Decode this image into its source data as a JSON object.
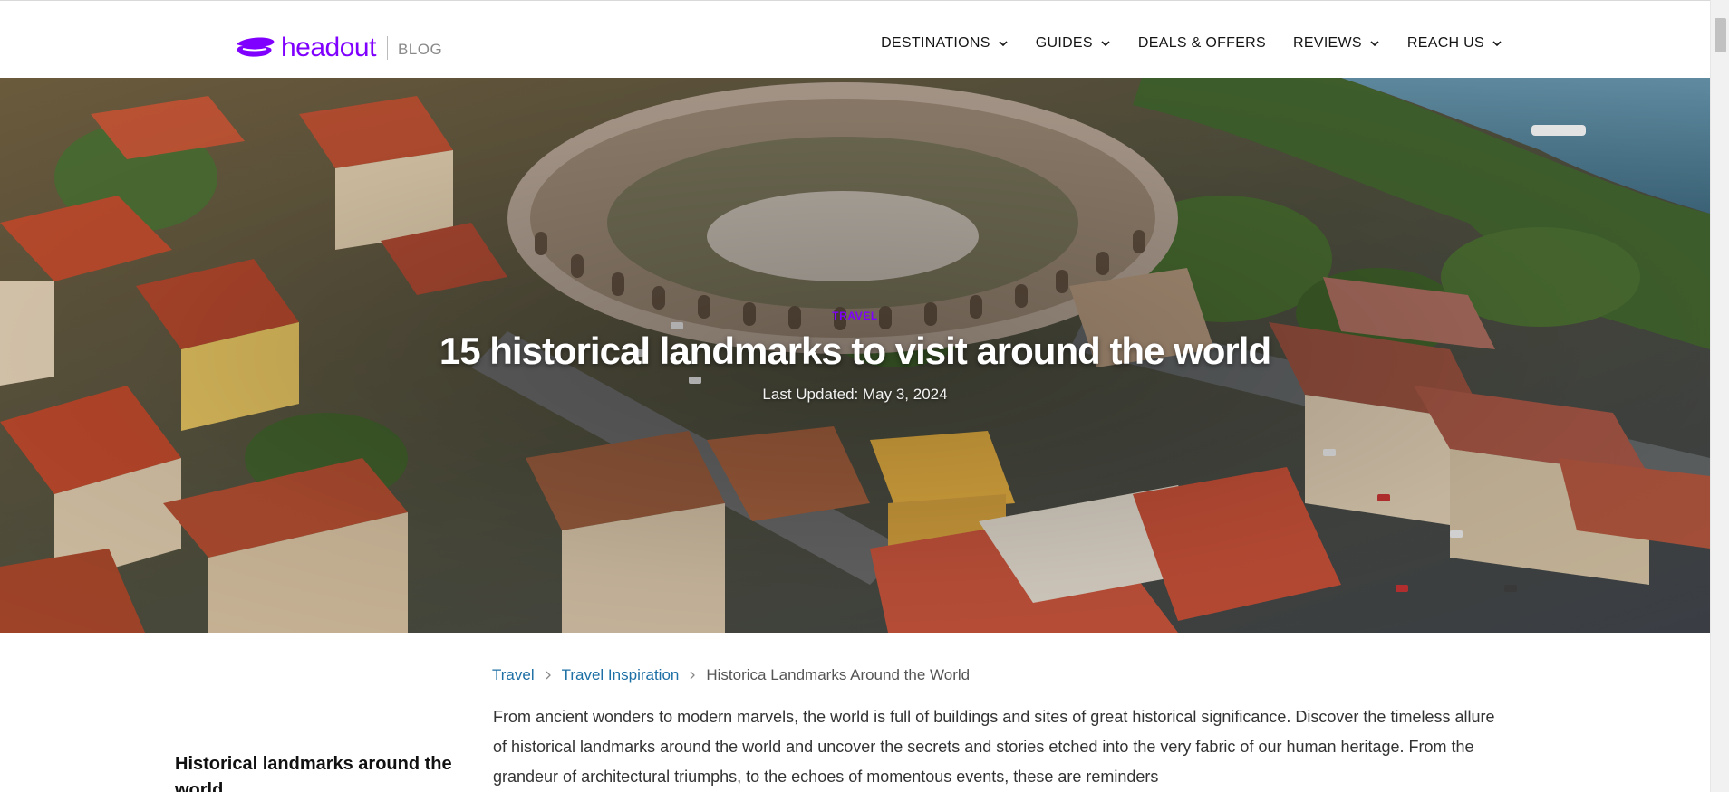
{
  "header": {
    "logo_text": "headout",
    "logo_suffix": "BLOG",
    "brand_color": "#8000ff",
    "nav": [
      {
        "label": "DESTINATIONS",
        "has_dropdown": true
      },
      {
        "label": "GUIDES",
        "has_dropdown": true
      },
      {
        "label": "DEALS & OFFERS",
        "has_dropdown": false
      },
      {
        "label": "REVIEWS",
        "has_dropdown": true
      },
      {
        "label": "REACH US",
        "has_dropdown": true
      }
    ]
  },
  "hero": {
    "category": "TRAVEL",
    "title": "15 historical landmarks to visit around the world",
    "last_updated": "Last Updated: May 3, 2024"
  },
  "breadcrumb": {
    "items": [
      "Travel",
      "Travel Inspiration"
    ],
    "current": "Historica Landmarks Around the World",
    "link_color": "#1d6fa5"
  },
  "article": {
    "intro": "From ancient wonders to modern marvels, the world is full of buildings and sites of great historical significance. Discover the timeless allure of historical landmarks around the world and uncover the secrets and stories etched into the very fabric of our human heritage. From the grandeur of architectural triumphs, to the echoes of momentous events, these are reminders"
  },
  "sidebar": {
    "toc_title": "Historical landmarks around the world"
  }
}
